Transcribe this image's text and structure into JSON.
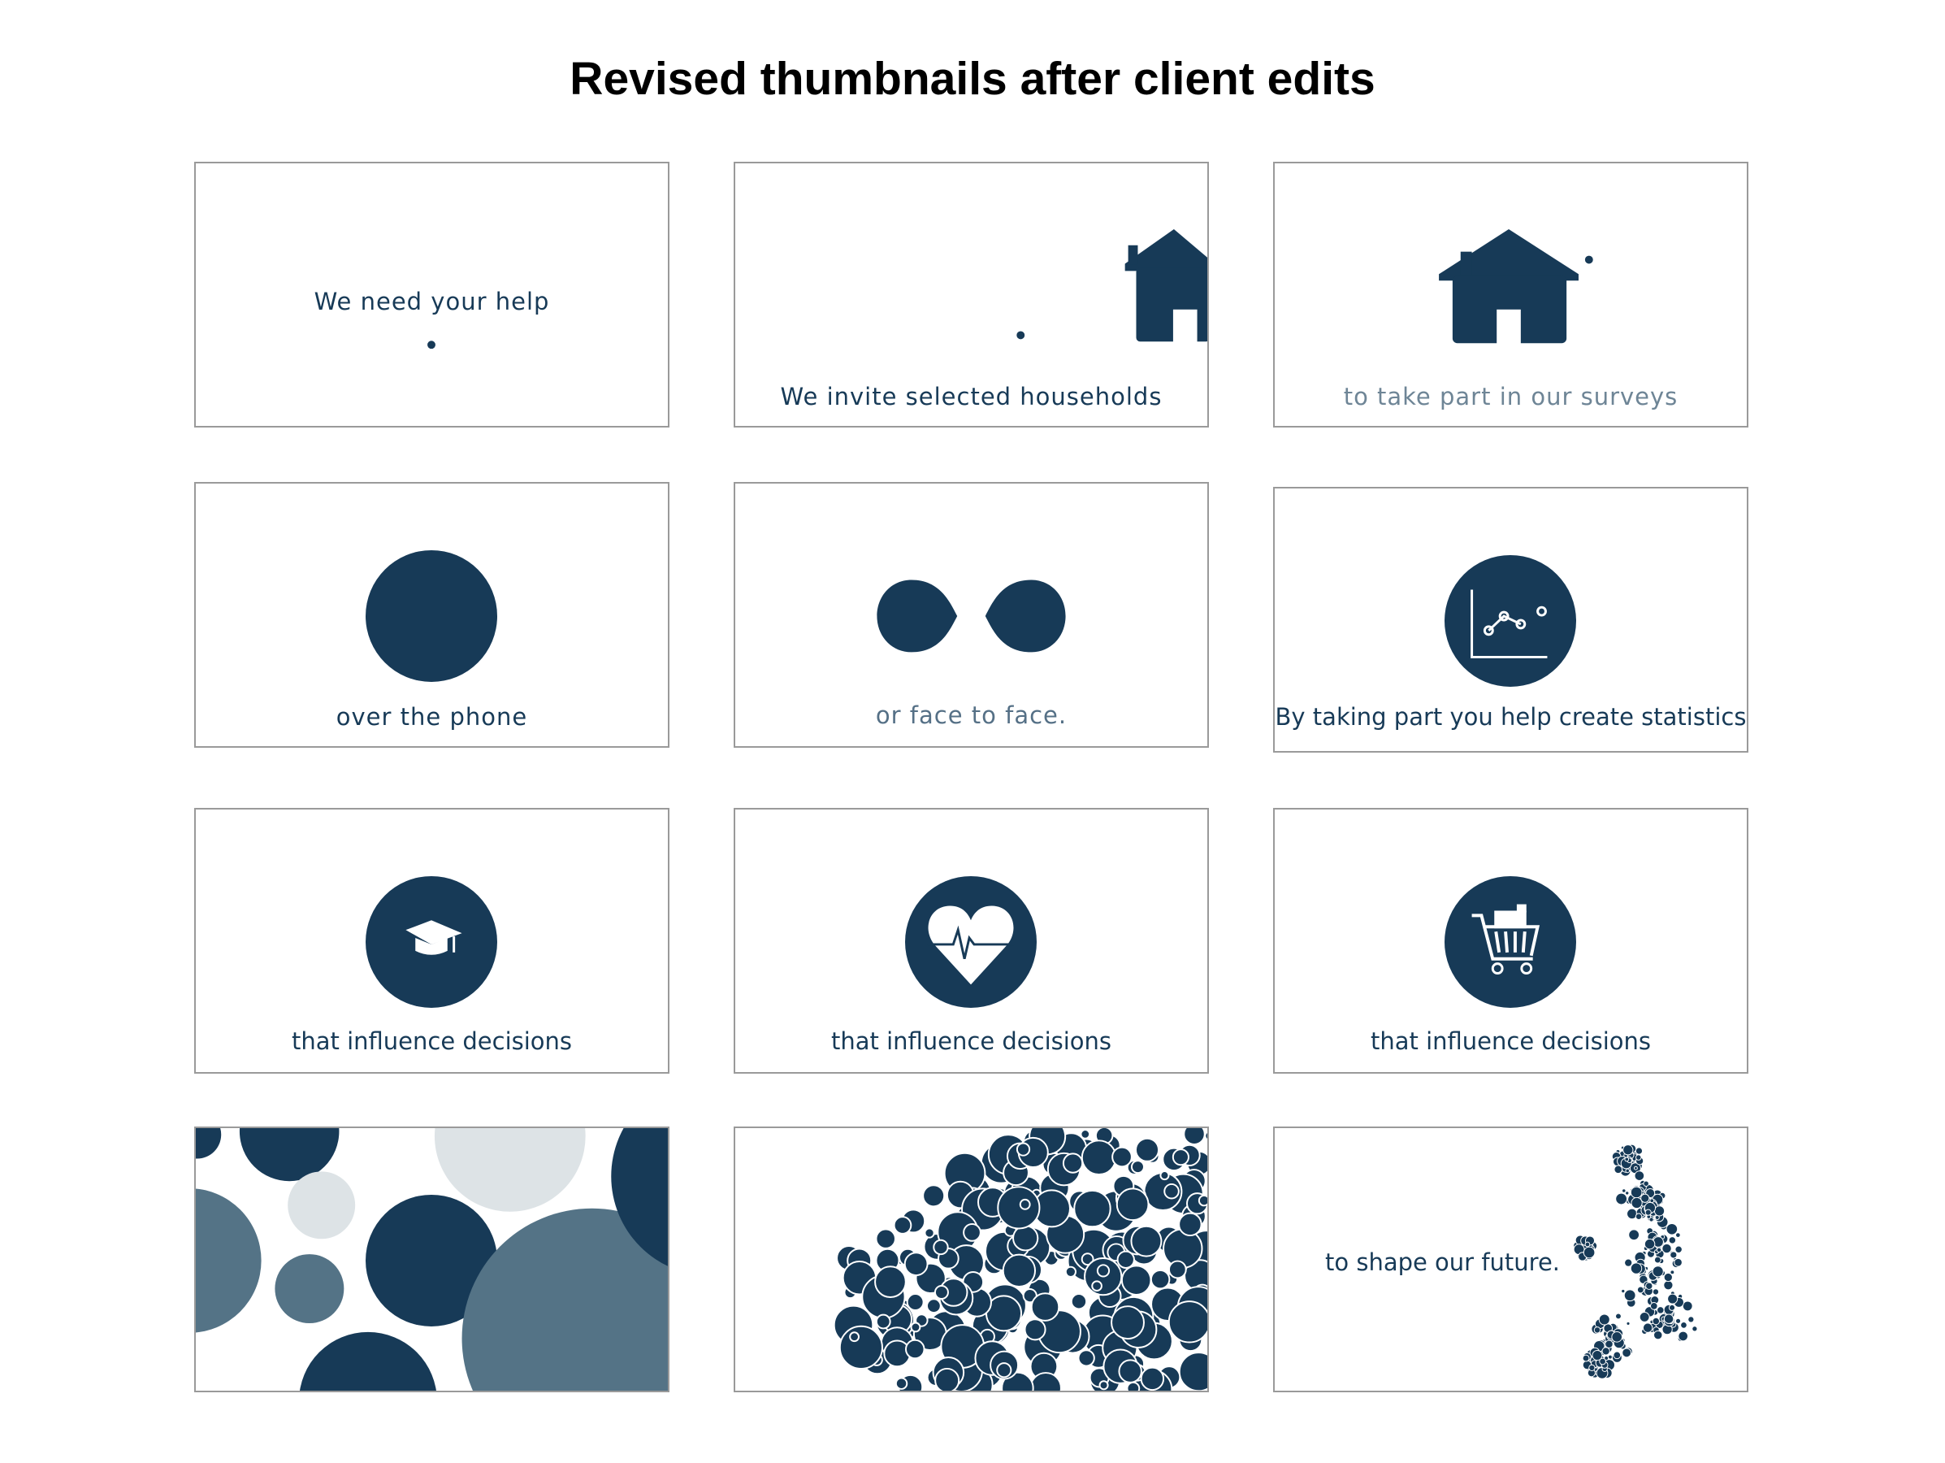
{
  "page": {
    "title": "Revised thumbnails after client edits"
  },
  "colors": {
    "navy": "#173a57",
    "slate": "#547386",
    "light_grey": "#dde3e6",
    "frame_border": "#9a9a9a"
  },
  "thumbnails": [
    {
      "caption": "We need your help",
      "icon": "dot"
    },
    {
      "caption": "We invite selected households",
      "icon": "house-icon"
    },
    {
      "caption": "to take part in our surveys",
      "icon": "house-icon"
    },
    {
      "caption": "over the phone",
      "icon": "circle"
    },
    {
      "caption": "or face to face.",
      "icon": "two-blobs"
    },
    {
      "caption": "By taking part you help create statistics",
      "icon": "chart-icon"
    },
    {
      "caption": "that influence decisions",
      "icon": "graduation-cap-icon"
    },
    {
      "caption": "that influence decisions",
      "icon": "heart-pulse-icon"
    },
    {
      "caption": "that influence decisions",
      "icon": "shopping-cart-icon"
    },
    {
      "caption": "",
      "icon": "bubbles"
    },
    {
      "caption": "",
      "icon": "bubble-cluster"
    },
    {
      "caption": "to shape our future.",
      "icon": "uk-map-icon"
    }
  ]
}
